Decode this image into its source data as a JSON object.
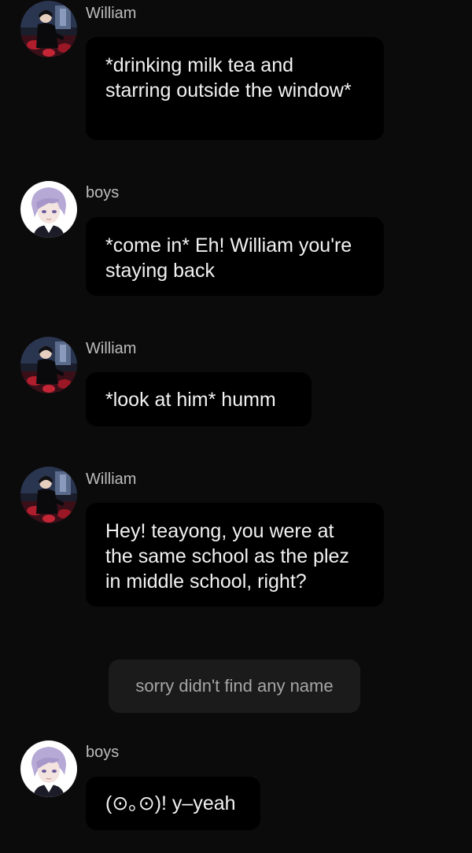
{
  "messages": [
    {
      "sender": "William",
      "text": "*drinking milk tea and starring outside the window*",
      "avatar": "william-avatar"
    },
    {
      "sender": "boys",
      "text": "*come in* Eh! William you're staying back",
      "avatar": "boys-avatar"
    },
    {
      "sender": "William",
      "text": "*look at him* humm",
      "avatar": "william-avatar"
    },
    {
      "sender": "William",
      "text": "Hey! teayong, you were at the same school as the plez in middle school, right?",
      "avatar": "william-avatar"
    },
    {
      "sender": "boys",
      "text": "(⊙｡⊙)! y–yeah",
      "avatar": "boys-avatar"
    }
  ],
  "system_message": "sorry didn't find any name",
  "colors": {
    "background": "#0b0b0b",
    "bubble": "#000000",
    "system_bubble": "#1b1b1b",
    "sender_text": "#bdbdbd",
    "message_text": "#f2f2f2"
  }
}
